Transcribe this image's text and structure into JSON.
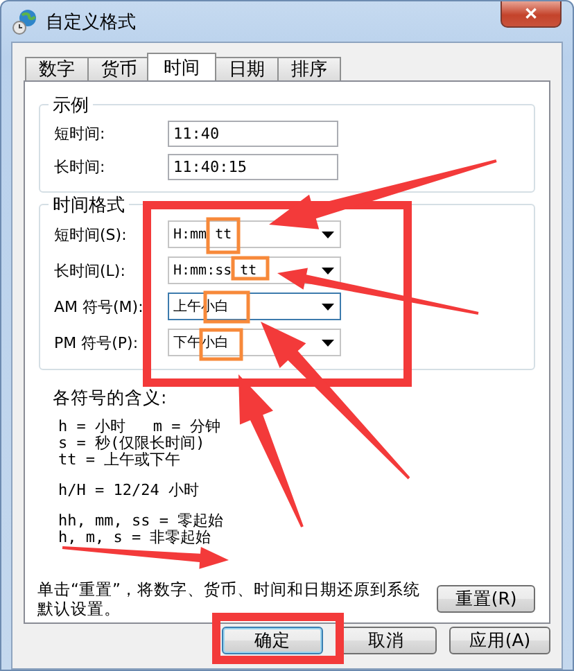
{
  "window": {
    "title": "自定义格式",
    "close": "✕"
  },
  "tabs": [
    {
      "label": "数字",
      "selected": false
    },
    {
      "label": "货币",
      "selected": false
    },
    {
      "label": "时间",
      "selected": true
    },
    {
      "label": "日期",
      "selected": false
    },
    {
      "label": "排序",
      "selected": false
    }
  ],
  "example": {
    "title": "示例",
    "rows": [
      {
        "label": "短时间:",
        "value": "11:40"
      },
      {
        "label": "长时间:",
        "value": "11:40:15"
      }
    ]
  },
  "format": {
    "title": "时间格式",
    "rows": [
      {
        "label": "短时间(S):",
        "value": "H:mm tt",
        "focused": false
      },
      {
        "label": "长时间(L):",
        "value": "H:mm:ss tt",
        "focused": false
      },
      {
        "label": "AM 符号(M):",
        "value": "上午小白",
        "focused": true
      },
      {
        "label": "PM 符号(P):",
        "value": "下午小白",
        "focused": false
      }
    ]
  },
  "legend": {
    "title": "各符号的含义:",
    "groups": [
      [
        "h = 小时   m = 分钟",
        "s = 秒(仅限长时间)",
        "tt = 上午或下午"
      ],
      [
        "h/H = 12/24 小时"
      ],
      [
        "hh, mm, ss = 零起始",
        "h, m, s = 非零起始"
      ]
    ]
  },
  "reset": {
    "text": "单击“重置”，将数字、货币、时间和日期还原到系统默认设置。",
    "button": "重置(R)"
  },
  "buttons": [
    {
      "label": "确定",
      "default": true
    },
    {
      "label": "取消",
      "default": false
    },
    {
      "label": "应用(A)",
      "default": false
    }
  ]
}
